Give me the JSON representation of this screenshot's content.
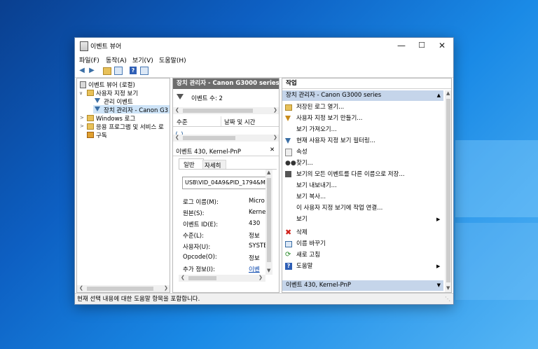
{
  "window": {
    "title": "이벤트 뷰어"
  },
  "menu": [
    "파일(F)",
    "동작(A)",
    "보기(V)",
    "도움말(H)"
  ],
  "tree": {
    "root": "이벤트 뷰어 (로컬)",
    "custom_views": "사용자 지정 보기",
    "admin_events": "관리 이벤트",
    "device_manager_view": "장치 관리자 - Canon G3",
    "windows_logs": "Windows 로그",
    "app_service_logs": "응용 프로그램 및 서비스 로",
    "subscriptions": "구독"
  },
  "middle": {
    "header": "장치 관리자 - Canon G3000 series",
    "event_count": "이벤트 수: 2",
    "columns": [
      "수준",
      "날짜 및 시간"
    ]
  },
  "detail": {
    "header": "이벤트 430, Kernel-PnP",
    "tabs": [
      "일반",
      "자세히"
    ],
    "device_id": "USB\\VID_04A9&PID_1794&M",
    "rows": [
      {
        "label": "로그 이름(M):",
        "value": "Micro"
      },
      {
        "label": "원본(S):",
        "value": "Kerne"
      },
      {
        "label": "이벤트 ID(E):",
        "value": "430"
      },
      {
        "label": "수준(L):",
        "value": "정보"
      },
      {
        "label": "사용자(U):",
        "value": "SYSTE"
      },
      {
        "label": "Opcode(O):",
        "value": "정보"
      },
      {
        "label": "추가 정보(I):",
        "value": "이벤"
      }
    ]
  },
  "actions": {
    "title": "작업",
    "section1": "장치 관리자 - Canon G3000 series",
    "items": [
      {
        "label": "저장된 로그 열기...",
        "icon": "folder-icon"
      },
      {
        "label": "사용자 지정 보기 만들기...",
        "icon": "filter-icon"
      },
      {
        "label": "보기 가져오기...",
        "icon": ""
      },
      {
        "label": "현재 사용자 지정 보기 필터링...",
        "icon": "filter-icon"
      },
      {
        "label": "속성",
        "icon": "properties-icon"
      },
      {
        "label": "찾기...",
        "icon": "binoculars-icon"
      },
      {
        "label": "보기의 모든 이벤트를 다른 이름으로 저장...",
        "icon": "save-icon"
      },
      {
        "label": "보기 내보내기...",
        "icon": ""
      },
      {
        "label": "보기 복사...",
        "icon": ""
      },
      {
        "label": "이 사용자 지정 보기에 작업 연결...",
        "icon": ""
      },
      {
        "label": "보기",
        "icon": ""
      },
      {
        "label": "삭제",
        "icon": "delete-icon"
      },
      {
        "label": "이름 바꾸기",
        "icon": "rename-icon"
      },
      {
        "label": "새로 고침",
        "icon": "refresh-icon"
      },
      {
        "label": "도움말",
        "icon": "help-icon"
      }
    ],
    "section2": "이벤트 430, Kernel-PnP"
  },
  "status": "현재 선택 내용에 대한 도움말 항목을 포함합니다."
}
